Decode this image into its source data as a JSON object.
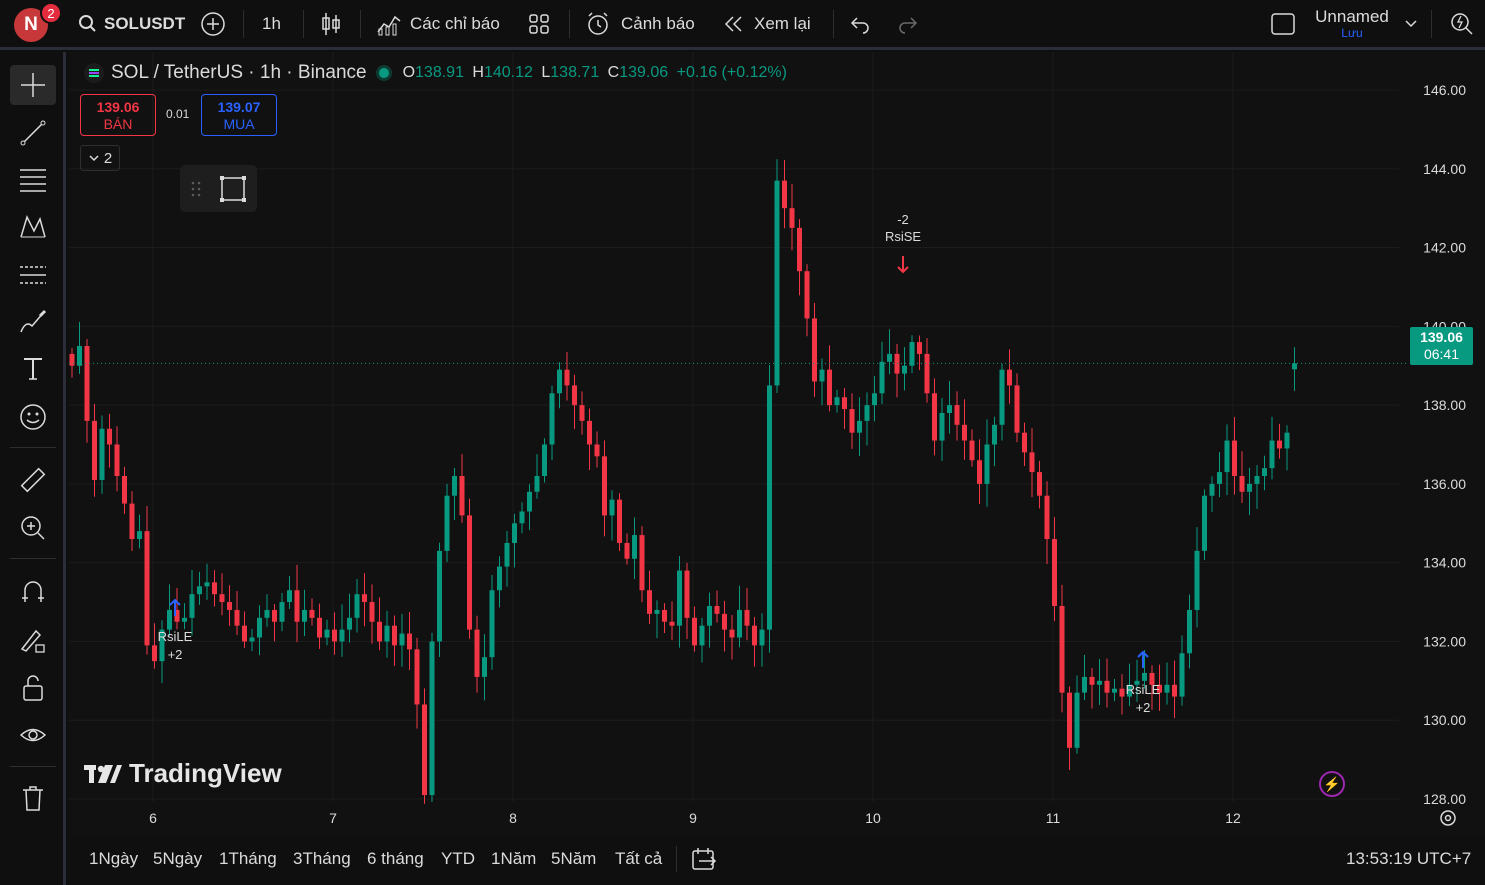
{
  "topbar": {
    "avatar_letter": "N",
    "avatar_badge": "2",
    "symbol": "SOLUSDT",
    "interval": "1h",
    "indicators_label": "Các chỉ báo",
    "alerts_label": "Cảnh báo",
    "replay_label": "Xem lại",
    "layout_name": "Unnamed",
    "save_label": "Lưu"
  },
  "legend": {
    "title": "SOL / TetherUS · 1h · Binance",
    "o_key": "O",
    "o": "138.91",
    "h_key": "H",
    "h": "140.12",
    "l_key": "L",
    "l": "138.71",
    "c_key": "C",
    "c": "139.06",
    "change": "+0.16 (+0.12%)"
  },
  "trade": {
    "sell_price": "139.06",
    "sell_label": "BÁN",
    "spread": "0.01",
    "buy_price": "139.07",
    "buy_label": "MUA",
    "collapse_count": "2"
  },
  "price_axis": [
    "146.00",
    "144.00",
    "142.00",
    "140.00",
    "138.00",
    "136.00",
    "134.00",
    "132.00",
    "130.00",
    "128.00"
  ],
  "time_axis": [
    "6",
    "7",
    "8",
    "9",
    "10",
    "11",
    "12"
  ],
  "last_price": {
    "price": "139.06",
    "countdown": "06:41"
  },
  "signals": [
    {
      "name": "RsiLE",
      "qty": "+2",
      "dir": "long"
    },
    {
      "name": "RsiSE",
      "qty": "-2",
      "dir": "short"
    },
    {
      "name": "RsiLE",
      "qty": "+2",
      "dir": "long"
    }
  ],
  "watermark": "TradingView",
  "ranges": [
    "1Ngày",
    "5Ngày",
    "1Tháng",
    "3Tháng",
    "6 tháng",
    "YTD",
    "1Năm",
    "5Năm",
    "Tất cả"
  ],
  "clock": "13:53:19 UTC+7",
  "colors": {
    "up": "#089981",
    "down": "#f23645",
    "accent": "#2962ff",
    "background": "#111111"
  },
  "chart_data": {
    "type": "candlestick",
    "ylim": [
      126.5,
      146.5
    ],
    "xlabels": [
      "6",
      "7",
      "8",
      "9",
      "10",
      "11",
      "12"
    ],
    "closes": [
      139.0,
      139.5,
      137.6,
      136.1,
      137.4,
      137.0,
      136.2,
      135.5,
      134.6,
      134.8,
      131.9,
      131.5,
      132.3,
      132.8,
      132.5,
      132.6,
      133.2,
      133.4,
      133.5,
      133.2,
      133.0,
      132.8,
      132.4,
      132.0,
      132.1,
      132.6,
      132.8,
      132.5,
      133.0,
      133.3,
      132.5,
      132.8,
      132.6,
      132.1,
      132.3,
      132.0,
      132.3,
      132.6,
      133.2,
      133.0,
      132.5,
      132.0,
      132.4,
      131.9,
      132.2,
      131.8,
      130.4,
      128.1,
      132.0,
      134.3,
      135.7,
      136.2,
      135.2,
      132.3,
      131.1,
      131.6,
      133.3,
      133.9,
      134.5,
      135.0,
      135.3,
      135.8,
      136.2,
      137.0,
      138.3,
      138.9,
      138.5,
      138.0,
      137.6,
      137.0,
      136.7,
      135.2,
      135.6,
      134.5,
      134.1,
      134.7,
      133.3,
      132.7,
      132.8,
      132.5,
      132.4,
      133.8,
      132.6,
      131.9,
      132.4,
      132.9,
      132.7,
      132.3,
      132.1,
      132.8,
      132.4,
      131.9,
      132.3,
      138.5,
      143.7,
      143.0,
      142.5,
      141.4,
      140.2,
      138.6,
      138.9,
      138.0,
      138.2,
      137.9,
      137.3,
      137.6,
      138.0,
      138.3,
      139.1,
      139.3,
      138.8,
      139.0,
      139.6,
      139.3,
      138.3,
      137.1,
      137.8,
      138.0,
      137.5,
      137.1,
      136.6,
      136.0,
      137.0,
      137.5,
      138.9,
      138.5,
      137.3,
      136.8,
      136.3,
      135.7,
      134.6,
      132.9,
      130.7,
      129.3,
      130.7,
      131.1,
      130.9,
      131.0,
      130.7,
      130.8,
      130.6,
      130.9,
      131.0,
      131.2,
      130.9,
      130.7,
      130.9,
      130.6,
      131.7,
      132.8,
      134.3,
      135.7,
      136.0,
      136.3,
      137.1,
      136.2,
      135.8,
      136.0,
      136.2,
      136.4,
      137.1,
      136.9,
      137.3,
      139.06
    ]
  }
}
